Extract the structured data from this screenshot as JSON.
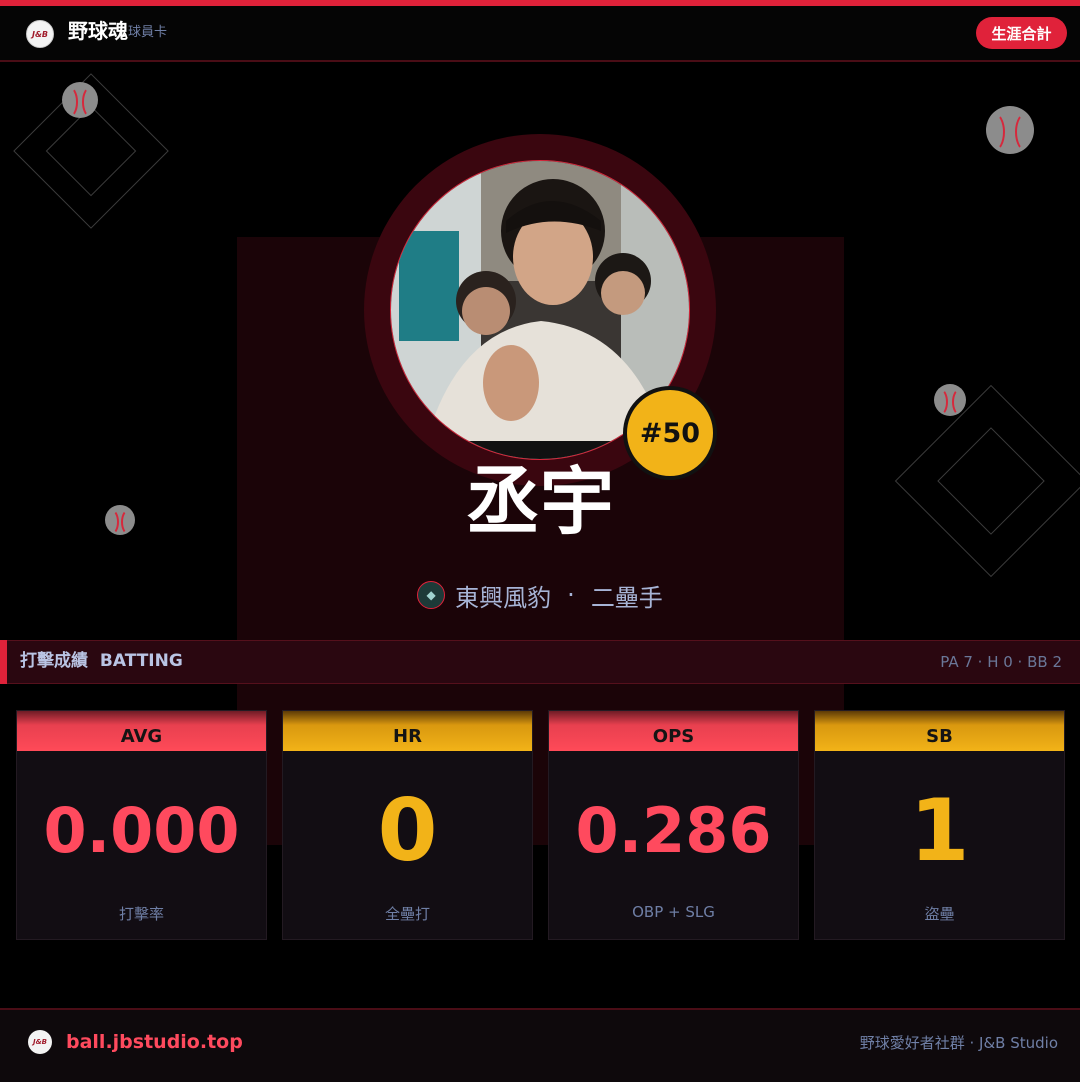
{
  "header": {
    "logo_text": "J&B",
    "brand": "野球魂",
    "subtitle": "球員卡",
    "career_button": "生涯合計"
  },
  "player": {
    "jersey": "#50",
    "name": "丞宇",
    "team": "東興風豹",
    "separator": "·",
    "position": "二壘手"
  },
  "batting": {
    "title": "打擊成績",
    "title_en": "BATTING",
    "summary": "PA 7 · H 0 · BB 2",
    "stats": [
      {
        "abbr": "AVG",
        "value": "0.000",
        "label": "打擊率",
        "color": "#ff4a5e"
      },
      {
        "abbr": "HR",
        "value": "0",
        "label": "全壘打",
        "color": "#f2b318"
      },
      {
        "abbr": "OPS",
        "value": "0.286",
        "label": "OBP + SLG",
        "color": "#ff4a5e"
      },
      {
        "abbr": "SB",
        "value": "1",
        "label": "盜壘",
        "color": "#f2b318"
      }
    ]
  },
  "footer": {
    "url": "ball.jbstudio.top",
    "credit": "野球愛好者社群 · J&B Studio"
  },
  "colors": {
    "accent_red": "#e0223a",
    "accent_gold": "#f2b318",
    "background": "#000000"
  }
}
